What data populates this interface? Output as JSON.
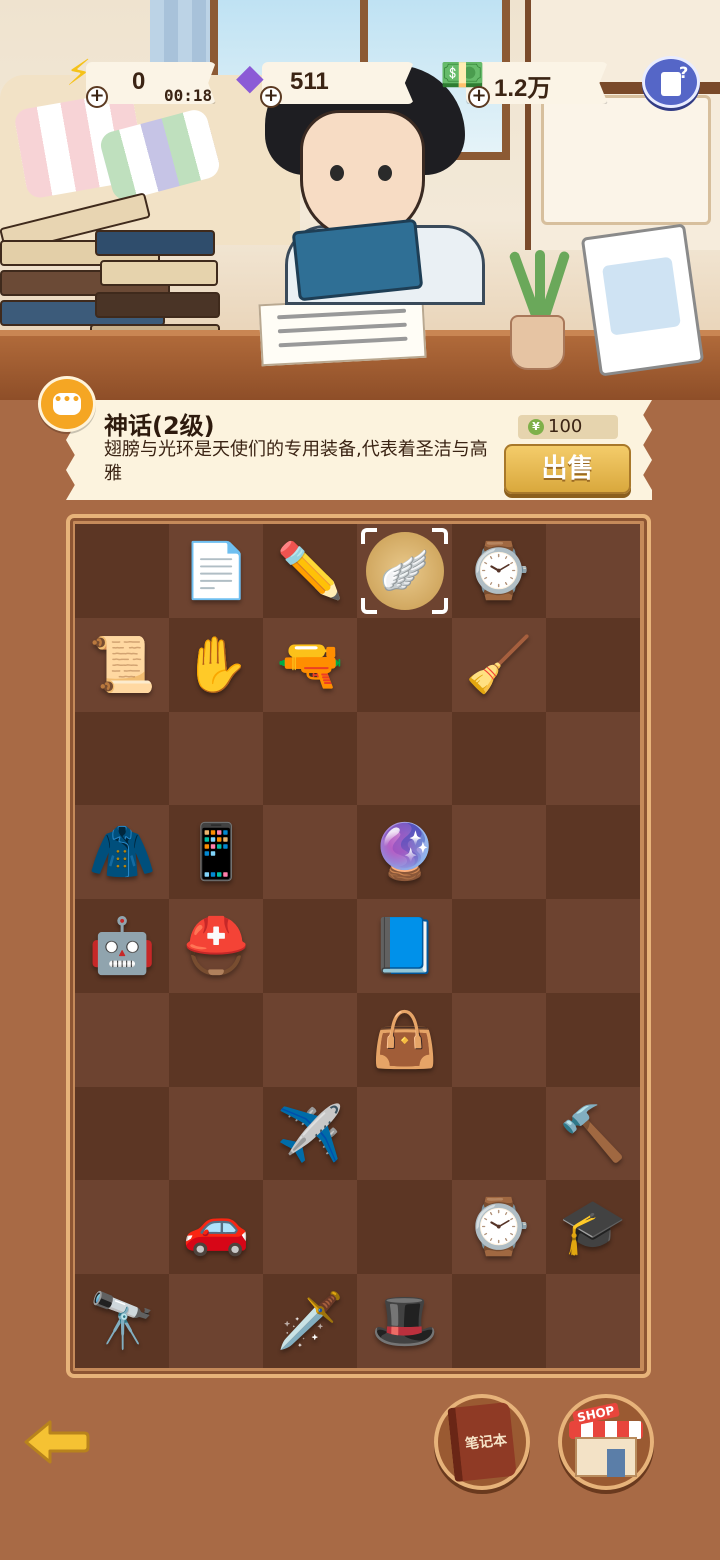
{
  "hud": {
    "energy": {
      "value": "0",
      "timer": "00:18",
      "icon": "lightning-icon"
    },
    "gems": {
      "value": "511",
      "icon": "purple-gem-icon"
    },
    "cash": {
      "value": "1.2万",
      "icon": "cash-stack-icon"
    },
    "help_icon": "help-notes-icon"
  },
  "item_info": {
    "title": "神话(2级)",
    "description": "翅膀与光环是天使们的专用装备,代表着圣洁与高雅",
    "price": "100",
    "price_currency_symbol": "¥",
    "sell_label": "出售"
  },
  "board": {
    "rows": 9,
    "cols": 6,
    "selected": {
      "row": 0,
      "col": 3
    },
    "items": [
      {
        "row": 0,
        "col": 1,
        "name": "test-paper-item",
        "glyph": "📄"
      },
      {
        "row": 0,
        "col": 2,
        "name": "pencil-item",
        "glyph": "✏️"
      },
      {
        "row": 0,
        "col": 3,
        "name": "wings-halo-item",
        "glyph": "🪽"
      },
      {
        "row": 0,
        "col": 4,
        "name": "digital-watch-item",
        "glyph": "⌚"
      },
      {
        "row": 1,
        "col": 0,
        "name": "scroll-item",
        "glyph": "📜"
      },
      {
        "row": 1,
        "col": 1,
        "name": "buddha-hand-item",
        "glyph": "✋"
      },
      {
        "row": 1,
        "col": 2,
        "name": "pistol-item",
        "glyph": "🔫"
      },
      {
        "row": 1,
        "col": 4,
        "name": "broom-item",
        "glyph": "🧹"
      },
      {
        "row": 3,
        "col": 0,
        "name": "cape-item",
        "glyph": "🧥"
      },
      {
        "row": 3,
        "col": 1,
        "name": "brick-phone-item",
        "glyph": "📱"
      },
      {
        "row": 3,
        "col": 3,
        "name": "crystal-ball-item",
        "glyph": "🔮"
      },
      {
        "row": 4,
        "col": 0,
        "name": "robot-item",
        "glyph": "🤖"
      },
      {
        "row": 4,
        "col": 1,
        "name": "viking-helmet-item",
        "glyph": "⛑️"
      },
      {
        "row": 4,
        "col": 3,
        "name": "magic-book-item",
        "glyph": "📘"
      },
      {
        "row": 5,
        "col": 3,
        "name": "handbag-item",
        "glyph": "👜"
      },
      {
        "row": 6,
        "col": 2,
        "name": "airplane-item",
        "glyph": "✈️"
      },
      {
        "row": 6,
        "col": 5,
        "name": "hammer-item",
        "glyph": "🔨"
      },
      {
        "row": 7,
        "col": 1,
        "name": "sports-car-item",
        "glyph": "🚗"
      },
      {
        "row": 7,
        "col": 4,
        "name": "wristwatch-item",
        "glyph": "⌚"
      },
      {
        "row": 7,
        "col": 5,
        "name": "graduation-cap-item",
        "glyph": "🎓"
      },
      {
        "row": 8,
        "col": 0,
        "name": "telescope-item",
        "glyph": "🔭"
      },
      {
        "row": 8,
        "col": 2,
        "name": "sword-item",
        "glyph": "🗡️"
      },
      {
        "row": 8,
        "col": 3,
        "name": "witch-hat-item",
        "glyph": "🎩"
      }
    ]
  },
  "bottom": {
    "back_icon": "back-arrow-icon",
    "notebook_label": "笔记本",
    "shop_label": "SHOP"
  },
  "colors": {
    "background": "#a86a45",
    "cell_dark": "#5c3624",
    "cell_light": "#6d4330",
    "sell_button": "#e5b54f",
    "accent_orange": "#f5a623"
  }
}
